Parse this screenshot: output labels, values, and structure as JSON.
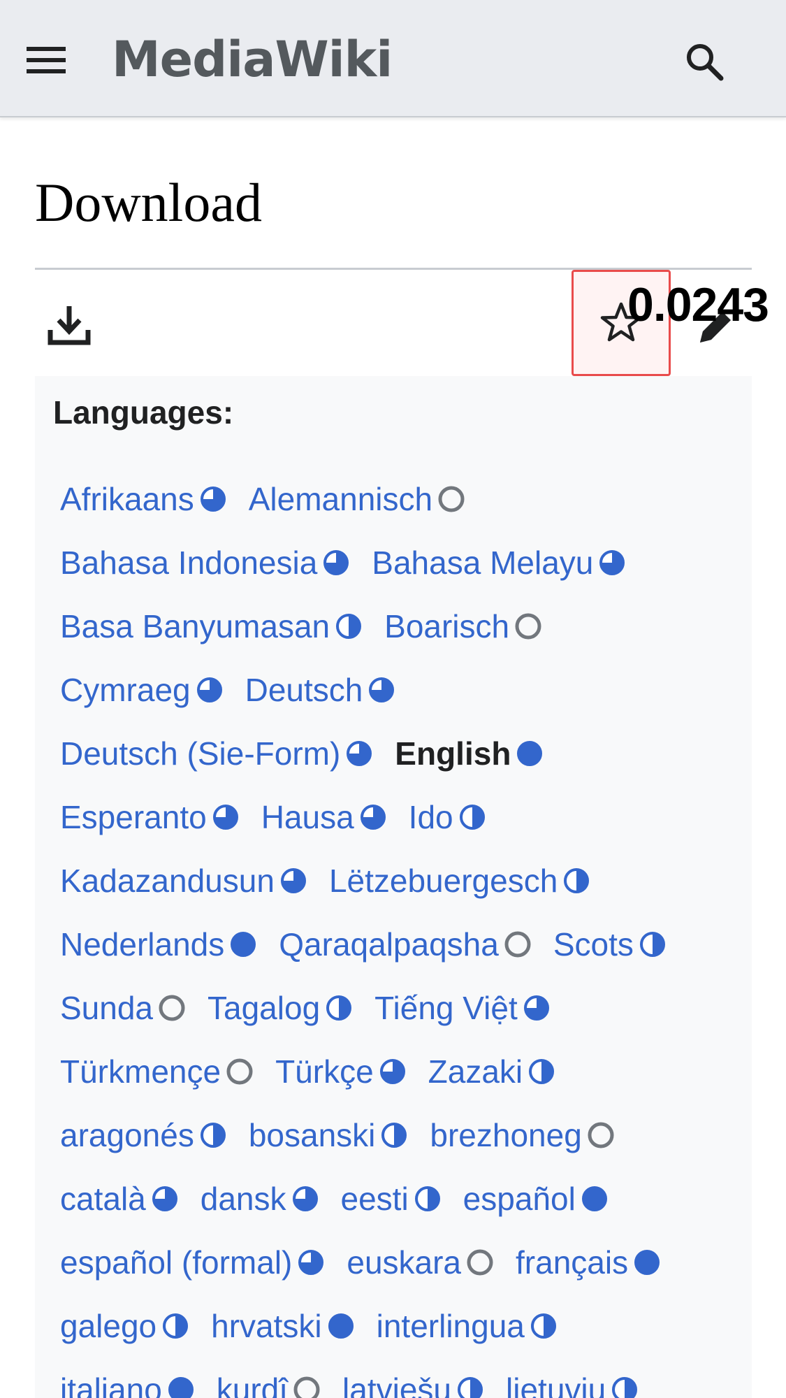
{
  "header": {
    "site_title": "MediaWiki",
    "menu_icon": "hamburger-menu-icon",
    "search_icon": "search-icon"
  },
  "page": {
    "title": "Download"
  },
  "actions": {
    "download_icon": "download-icon",
    "watch_icon": "star-icon",
    "edit_icon": "pencil-icon",
    "overlay_text": "0.0243"
  },
  "languages": {
    "label": "Languages:",
    "rows": [
      [
        {
          "name": "Afrikaans",
          "status": "3q"
        },
        {
          "name": "Alemannisch",
          "status": "0"
        }
      ],
      [
        {
          "name": "Bahasa Indonesia",
          "status": "3q"
        },
        {
          "name": "Bahasa Melayu",
          "status": "3q"
        }
      ],
      [
        {
          "name": "Basa Banyumasan",
          "status": "half"
        },
        {
          "name": "Boarisch",
          "status": "0"
        }
      ],
      [
        {
          "name": "Cymraeg",
          "status": "3q"
        },
        {
          "name": "Deutsch",
          "status": "3q"
        }
      ],
      [
        {
          "name": "Deutsch (Sie-Form)",
          "status": "3q"
        },
        {
          "name": "English",
          "status": "full",
          "current": true
        }
      ],
      [
        {
          "name": "Esperanto",
          "status": "3q"
        },
        {
          "name": "Hausa",
          "status": "3q"
        },
        {
          "name": "Ido",
          "status": "half"
        }
      ],
      [
        {
          "name": "Kadazandusun",
          "status": "3q"
        },
        {
          "name": "Lëtzebuergesch",
          "status": "half"
        }
      ],
      [
        {
          "name": "Nederlands",
          "status": "full"
        },
        {
          "name": "Qaraqalpaqsha",
          "status": "0"
        },
        {
          "name": "Scots",
          "status": "half"
        }
      ],
      [
        {
          "name": "Sunda",
          "status": "0"
        },
        {
          "name": "Tagalog",
          "status": "half"
        },
        {
          "name": "Tiếng Việt",
          "status": "3q"
        }
      ],
      [
        {
          "name": "Türkmençe",
          "status": "0"
        },
        {
          "name": "Türkçe",
          "status": "3q"
        },
        {
          "name": "Zazaki",
          "status": "half"
        }
      ],
      [
        {
          "name": "aragonés",
          "status": "half"
        },
        {
          "name": "bosanski",
          "status": "half"
        },
        {
          "name": "brezhoneg",
          "status": "0"
        }
      ],
      [
        {
          "name": "català",
          "status": "3q"
        },
        {
          "name": "dansk",
          "status": "3q"
        },
        {
          "name": "eesti",
          "status": "half"
        },
        {
          "name": "español",
          "status": "full"
        }
      ],
      [
        {
          "name": "español (formal)",
          "status": "3q"
        },
        {
          "name": "euskara",
          "status": "0"
        },
        {
          "name": "français",
          "status": "full"
        }
      ],
      [
        {
          "name": "galego",
          "status": "half"
        },
        {
          "name": "hrvatski",
          "status": "full"
        },
        {
          "name": "interlingua",
          "status": "half"
        }
      ],
      [
        {
          "name": "italiano",
          "status": "full"
        },
        {
          "name": "kurdî",
          "status": "0"
        },
        {
          "name": "latviešu",
          "status": "half"
        },
        {
          "name": "lietuvių",
          "status": "half"
        }
      ]
    ]
  },
  "colors": {
    "link": "#3366cc",
    "header_bg": "#eaecf0",
    "highlight_border": "#e94b4b"
  }
}
